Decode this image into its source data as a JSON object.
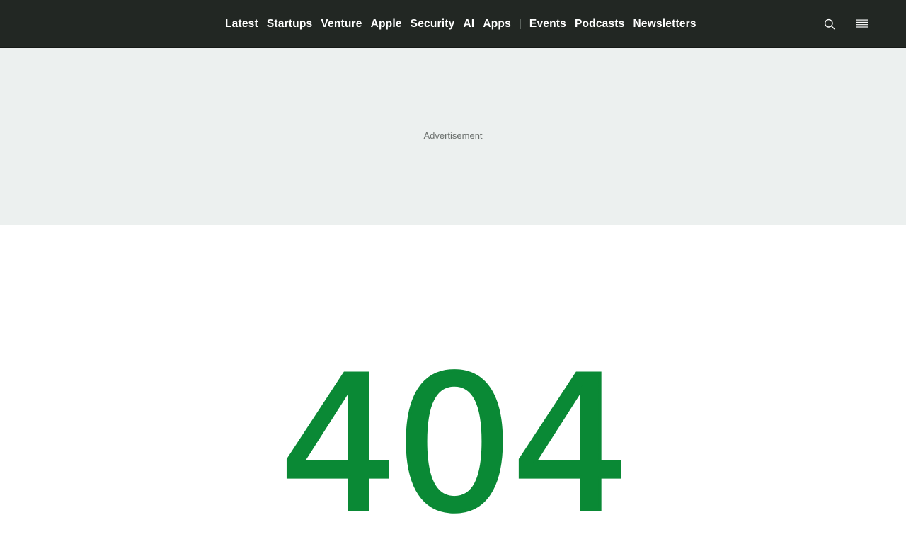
{
  "nav": {
    "primary_items": [
      {
        "label": "Latest"
      },
      {
        "label": "Startups"
      },
      {
        "label": "Venture"
      },
      {
        "label": "Apple"
      },
      {
        "label": "Security"
      },
      {
        "label": "AI"
      },
      {
        "label": "Apps"
      }
    ],
    "secondary_items": [
      {
        "label": "Events"
      },
      {
        "label": "Podcasts"
      },
      {
        "label": "Newsletters"
      }
    ],
    "search_icon": "search-icon",
    "menu_icon": "hamburger-menu-icon"
  },
  "ad": {
    "label": "Advertisement"
  },
  "error": {
    "code": "404"
  },
  "colors": {
    "topbar_bg": "#222723",
    "ad_bg": "#ecf0ef",
    "accent_green": "#0a8935",
    "nav_text": "#ffffff"
  }
}
